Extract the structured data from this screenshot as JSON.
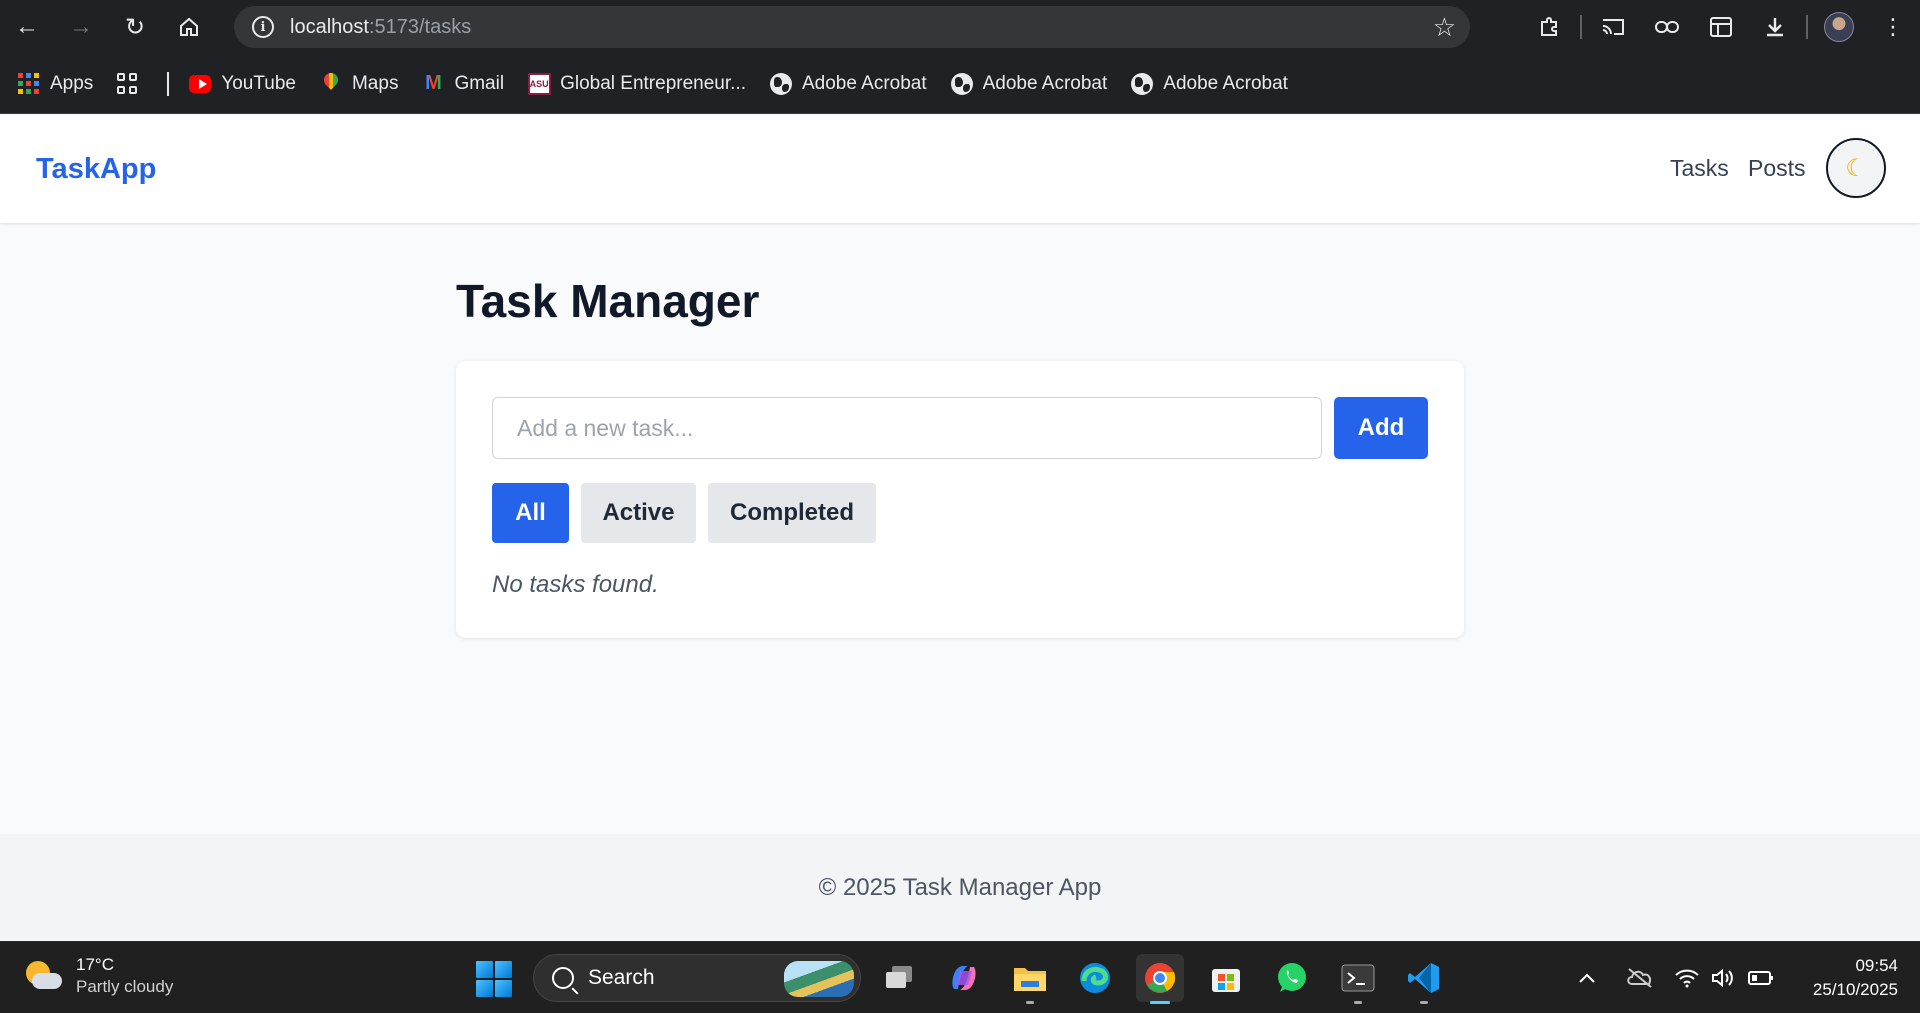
{
  "browser": {
    "url_host": "localhost",
    "url_path": ":5173/tasks",
    "bookmarks": [
      {
        "label": "Apps"
      },
      {
        "label": "YouTube"
      },
      {
        "label": "Maps"
      },
      {
        "label": "Gmail"
      },
      {
        "label": "Global Entrepreneur..."
      },
      {
        "label": "Adobe Acrobat"
      },
      {
        "label": "Adobe Acrobat"
      },
      {
        "label": "Adobe Acrobat"
      }
    ]
  },
  "app": {
    "brand": "TaskApp",
    "nav": {
      "tasks": "Tasks",
      "posts": "Posts"
    },
    "theme_icon": "moon-icon",
    "brand_color": "#2563eb"
  },
  "main": {
    "title": "Task Manager",
    "input_placeholder": "Add a new task...",
    "input_value": "",
    "add_label": "Add",
    "filters": {
      "all": "All",
      "active": "Active",
      "completed": "Completed"
    },
    "selected_filter": "All",
    "empty_message": "No tasks found."
  },
  "footer": {
    "text": "© 2025 Task Manager App"
  },
  "taskbar": {
    "weather_temp": "17°C",
    "weather_desc": "Partly cloudy",
    "search_label": "Search",
    "time": "09:54",
    "date": "25/10/2025"
  }
}
